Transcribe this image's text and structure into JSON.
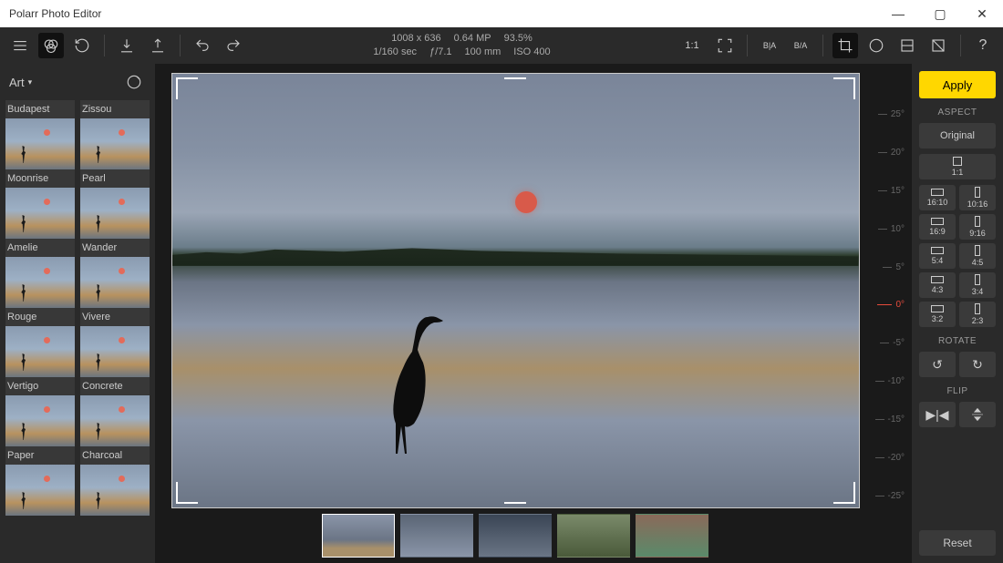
{
  "app": {
    "title": "Polarr Photo Editor"
  },
  "meta": {
    "dimensions": "1008 x 636",
    "megapixels": "0.64 MP",
    "zoom": "93.5%",
    "shutter": "1/160 sec",
    "aperture": "ƒ/7.1",
    "focal": "100 mm",
    "iso": "ISO 400"
  },
  "filters": {
    "category": "Art",
    "items": [
      {
        "name": "Budapest"
      },
      {
        "name": "Zissou"
      },
      {
        "name": "Moonrise"
      },
      {
        "name": "Pearl"
      },
      {
        "name": "Amelie"
      },
      {
        "name": "Wander"
      },
      {
        "name": "Rouge"
      },
      {
        "name": "Vivere"
      },
      {
        "name": "Vertigo"
      },
      {
        "name": "Concrete"
      },
      {
        "name": "Paper"
      },
      {
        "name": "Charcoal"
      }
    ]
  },
  "angleScale": [
    "25°",
    "20°",
    "15°",
    "10°",
    "5°",
    "0°",
    "-5°",
    "-10°",
    "-15°",
    "-20°",
    "-25°"
  ],
  "crop": {
    "apply": "Apply",
    "aspect_label": "ASPECT",
    "original": "Original",
    "ratios": [
      {
        "label": "1:1",
        "shape": "sq"
      },
      {
        "label": "16:10",
        "shape": "wide"
      },
      {
        "label": "10:16",
        "shape": "tall"
      },
      {
        "label": "16:9",
        "shape": "wide"
      },
      {
        "label": "9:16",
        "shape": "tall"
      },
      {
        "label": "5:4",
        "shape": "wide"
      },
      {
        "label": "4:5",
        "shape": "tall"
      },
      {
        "label": "4:3",
        "shape": "wide"
      },
      {
        "label": "3:4",
        "shape": "tall"
      },
      {
        "label": "3:2",
        "shape": "wide"
      },
      {
        "label": "2:3",
        "shape": "tall"
      }
    ],
    "rotate_label": "ROTATE",
    "flip_label": "FLIP",
    "reset": "Reset"
  }
}
